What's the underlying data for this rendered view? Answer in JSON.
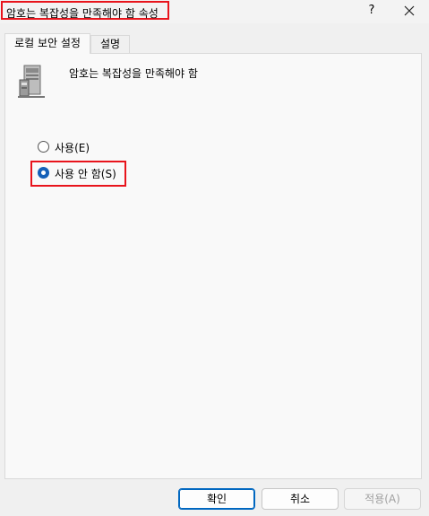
{
  "dialog": {
    "title": "암호는 복잡성을 만족해야 함 속성",
    "help": "?"
  },
  "tabs": [
    {
      "label": "로컬 보안 설정",
      "active": true
    },
    {
      "label": "설명",
      "active": false
    }
  ],
  "policy": {
    "name": "암호는 복잡성을 만족해야 함",
    "icon": "server-icon"
  },
  "options": [
    {
      "label": "사용(E)",
      "selected": false
    },
    {
      "label": "사용 안 함(S)",
      "selected": true
    }
  ],
  "buttons": {
    "ok": "확인",
    "cancel": "취소",
    "apply": "적용(A)"
  },
  "colors": {
    "highlight": "#e8141c",
    "accent": "#0067c0"
  }
}
